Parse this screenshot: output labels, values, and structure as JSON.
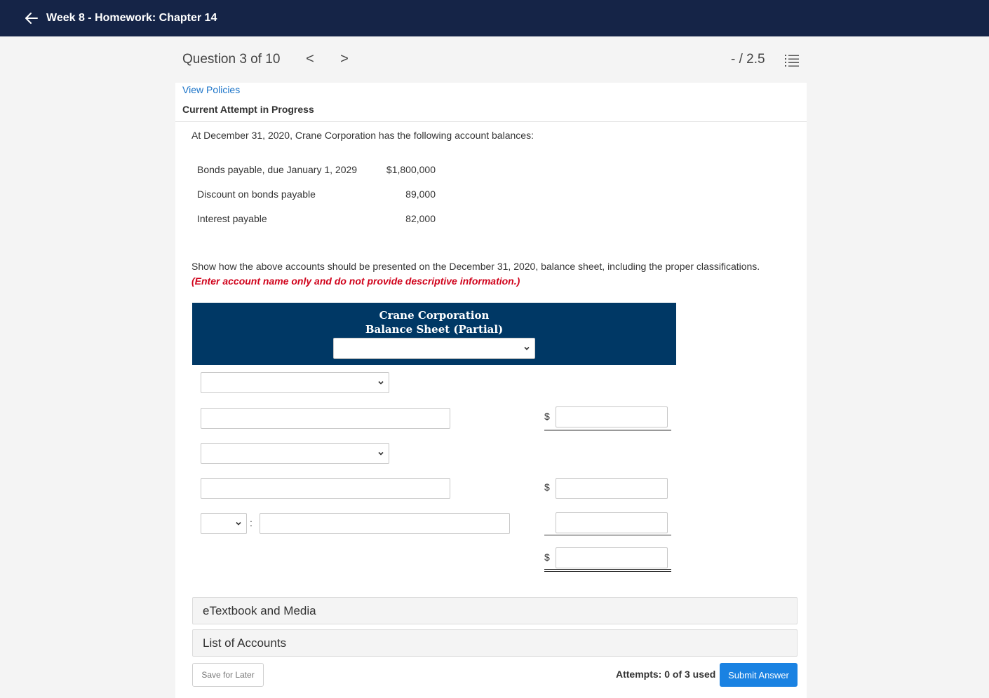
{
  "topbar": {
    "title": "Week 8 - Homework: Chapter 14",
    "back_icon": "arrow-left-icon"
  },
  "question_nav": {
    "label": "Question 3 of 10",
    "prev_symbol": "<",
    "next_symbol": ">",
    "score": "- / 2.5",
    "list_icon": "list-icon"
  },
  "question": {
    "view_policies": "View Policies",
    "attempt_status": "Current Attempt in Progress",
    "intro": "At December 31, 2020, Crane Corporation has the following account balances:",
    "accounts": [
      {
        "name": "Bonds payable, due January 1, 2029",
        "amount": "$1,800,000"
      },
      {
        "name": "Discount on bonds payable",
        "amount": "89,000"
      },
      {
        "name": "Interest payable",
        "amount": "82,000"
      }
    ],
    "instructions": "Show how the above accounts should be presented on the December 31, 2020, balance sheet, including the proper classifications.",
    "hint": "(Enter account name only and do not provide descriptive information.)"
  },
  "balance_sheet": {
    "company": "Crane Corporation",
    "title": "Balance Sheet (Partial)",
    "date_select": "",
    "classification_1": "",
    "account_1": "",
    "amount_1": "",
    "classification_2": "",
    "account_2": "",
    "amount_2": "",
    "operator_select": "",
    "account_3": "",
    "amount_3": "",
    "total_amount": "",
    "dollar_sign": "$",
    "colon": ":"
  },
  "panels": {
    "etextbook": "eTextbook and Media",
    "list_of_accounts": "List of Accounts"
  },
  "footer": {
    "save_label": "Save for Later",
    "attempts": "Attempts: 0 of 3 used",
    "submit_label": "Submit Answer"
  },
  "colors": {
    "topbar": "#152447",
    "header": "#003865",
    "link": "#1a73c8",
    "hint": "#d0021b",
    "submit": "#1a82e2"
  }
}
